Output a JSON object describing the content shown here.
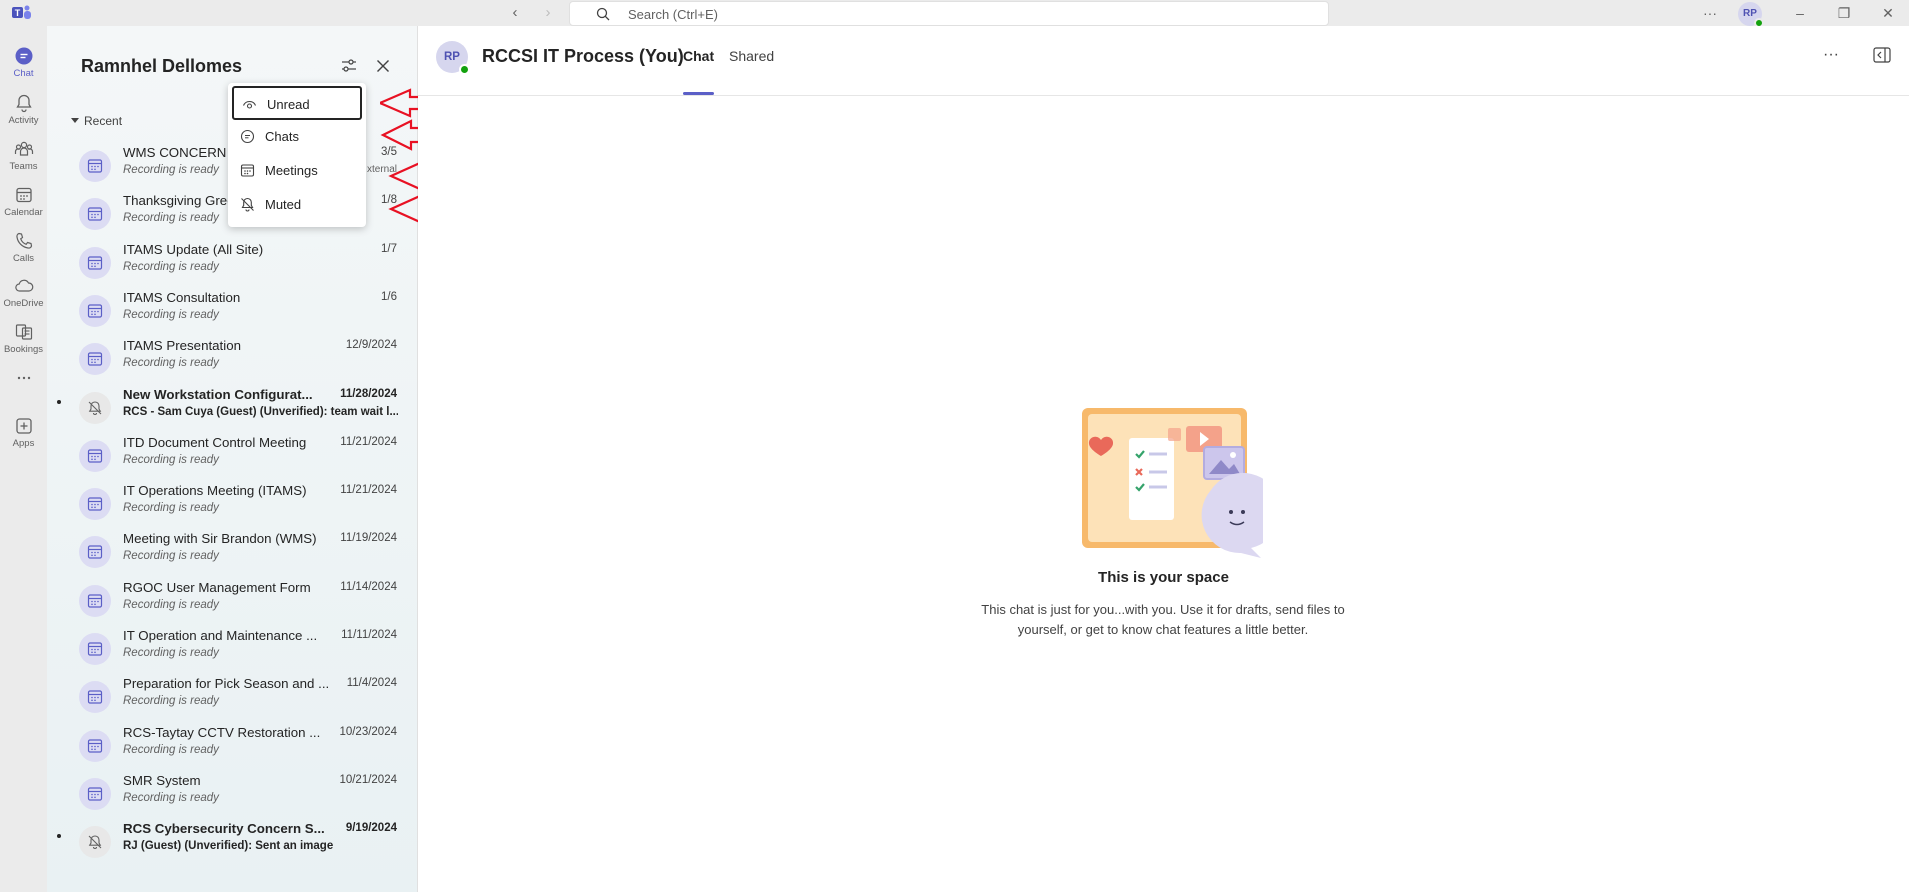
{
  "titlebar": {
    "search_placeholder": "Search (Ctrl+E)",
    "more": "···",
    "user_initials": "RP"
  },
  "rail": {
    "items": [
      {
        "label": "Chat",
        "icon": "chat-icon",
        "active": true
      },
      {
        "label": "Activity",
        "icon": "bell-icon"
      },
      {
        "label": "Teams",
        "icon": "teams-icon"
      },
      {
        "label": "Calendar",
        "icon": "calendar-icon"
      },
      {
        "label": "Calls",
        "icon": "phone-icon"
      },
      {
        "label": "OneDrive",
        "icon": "cloud-icon"
      },
      {
        "label": "Bookings",
        "icon": "bookings-icon"
      },
      {
        "label": "",
        "icon": "more-icon"
      },
      {
        "label": "Apps",
        "icon": "plus-icon"
      }
    ]
  },
  "list": {
    "title": "Ramnhel Dellomes",
    "section": "Recent",
    "items": [
      {
        "name": "WMS CONCERN",
        "date": "3/5",
        "sub": "Recording is ready",
        "extra": "xternal"
      },
      {
        "name": "Thanksgiving Greetings",
        "date": "1/8",
        "sub": "Recording is ready"
      },
      {
        "name": "ITAMS Update (All Site)",
        "date": "1/7",
        "sub": "Recording is ready"
      },
      {
        "name": "ITAMS Consultation",
        "date": "1/6",
        "sub": "Recording is ready"
      },
      {
        "name": "ITAMS Presentation",
        "date": "12/9/2024",
        "sub": "Recording is ready"
      },
      {
        "name": "New Workstation Configurat...",
        "date": "11/28/2024",
        "sub": "RCS - Sam Cuya (Guest) (Unverified): team wait l...",
        "unread": true,
        "muted": true
      },
      {
        "name": "ITD Document Control Meeting",
        "date": "11/21/2024",
        "sub": "Recording is ready"
      },
      {
        "name": "IT Operations Meeting (ITAMS)",
        "date": "11/21/2024",
        "sub": "Recording is ready"
      },
      {
        "name": "Meeting with Sir Brandon (WMS)",
        "date": "11/19/2024",
        "sub": "Recording is ready"
      },
      {
        "name": "RGOC User Management Form",
        "date": "11/14/2024",
        "sub": "Recording is ready"
      },
      {
        "name": "IT Operation and Maintenance ...",
        "date": "11/11/2024",
        "sub": "Recording is ready"
      },
      {
        "name": "Preparation for Pick Season and ...",
        "date": "11/4/2024",
        "sub": "Recording is ready"
      },
      {
        "name": "RCS-Taytay CCTV Restoration ...",
        "date": "10/23/2024",
        "sub": "Recording is ready"
      },
      {
        "name": "SMR System",
        "date": "10/21/2024",
        "sub": "Recording is ready"
      },
      {
        "name": "RCS Cybersecurity Concern S...",
        "date": "9/19/2024",
        "sub": "RJ (Guest) (Unverified): Sent an image",
        "unread": true,
        "muted": true
      }
    ]
  },
  "filter_menu": {
    "items": [
      {
        "label": "Unread",
        "icon": "eye-icon",
        "selected": true
      },
      {
        "label": "Chats",
        "icon": "chat-bubble-icon"
      },
      {
        "label": "Meetings",
        "icon": "calendar-icon"
      },
      {
        "label": "Muted",
        "icon": "bell-off-icon"
      }
    ]
  },
  "main": {
    "initials": "RP",
    "title": "RCCSI IT Process (You)",
    "tabs": [
      "Chat",
      "Shared"
    ],
    "more": "···",
    "empty_title": "This is your space",
    "empty_desc": "This chat is just for you...with you. Use it for drafts, send files to yourself, or get to know chat features a little better."
  },
  "colors": {
    "accent": "#5b5fc7",
    "presence": "#13a10e",
    "annotation_arrow": "#e81123"
  }
}
